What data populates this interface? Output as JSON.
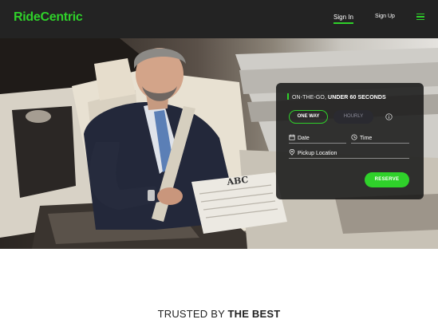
{
  "header": {
    "logo": "RideCentric",
    "nav": {
      "sign_in": "Sign In",
      "sign_up": "Sign Up"
    },
    "accent_color": "#2fd12a",
    "menu_icon": "hamburger-menu-icon"
  },
  "hero": {
    "image": "businessman-reading-newspaper-in-limousine",
    "newspaper_masthead": "ABC"
  },
  "booking": {
    "tagline_prefix": "ON-THE-GO, ",
    "tagline_emphasis": "UNDER 60 SECONDS",
    "trip_types": [
      "ONE WAY",
      "HOURLY"
    ],
    "selected_trip_type": "ONE WAY",
    "date_placeholder": "Date",
    "time_placeholder": "Time",
    "pickup_placeholder": "Pickup Location",
    "reserve_label": "RESERVE",
    "icons": [
      "info-icon",
      "calendar-icon",
      "clock-icon",
      "location-pin-icon"
    ]
  },
  "trusted": {
    "prefix": "TRUSTED BY ",
    "emphasis": "THE BEST"
  }
}
